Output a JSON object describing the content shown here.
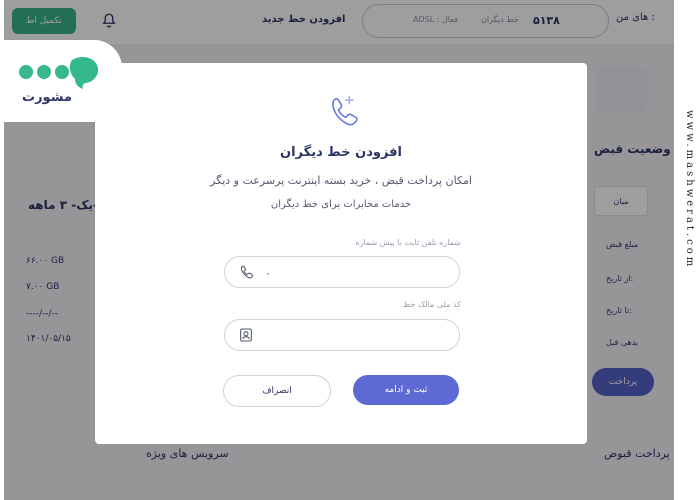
{
  "header": {
    "complete_button": "تکمیل اط",
    "add_line_link": "افزودن خط جدید",
    "line_number": "۵۱۳۸",
    "line_meta": "ADSL : فعال",
    "line_type": "خط دیگران",
    "my_lines": "های من :"
  },
  "background": {
    "left_title": "یک- ۳ ماهه-",
    "left_values": [
      "۶۶.۰۰ GB",
      "۷.۰۰ GB",
      "----/--/--",
      "۱۴۰۱/۰۵/۱۵"
    ],
    "right_title": "وضعیت قبض",
    "right_tab": "میان",
    "side_rows": [
      "مبلغ قبض",
      "از تاریخ:",
      "تا تاریخ:",
      "بدهی قبل"
    ],
    "pay_button": "پرداخت",
    "bottom_left": "سرویس های ویژه",
    "bottom_right": "پرداخت قبوض"
  },
  "modal": {
    "icon": "phone-plus-icon",
    "title": "افزودن خط دیگران",
    "desc_line1": "امکان پرداخت قبض ، خرید بسته اینترنت پرسرعت و دیگر",
    "desc_line2": "خدمات مخابرات برای خط دیگران",
    "phone_label": "شماره تلفن ثابت با پیش شماره",
    "phone_value": "۰",
    "national_id_label": "کد ملی مالک خط",
    "national_id_value": "",
    "cancel_label": "انصراف",
    "submit_label": "ثبت و ادامه"
  },
  "logo": {
    "text": "مشورت"
  },
  "watermark": "www.mashwerat.com",
  "colors": {
    "accent": "#5d6ad3",
    "green": "#38b48a",
    "text_dark": "#2d3466"
  }
}
